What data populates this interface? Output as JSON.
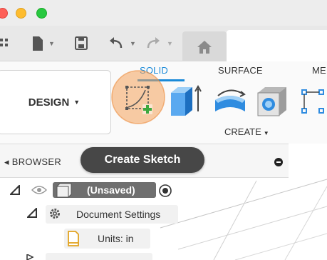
{
  "ribbon": {
    "workspace_label": "DESIGN",
    "tabs": [
      {
        "label": "SOLID",
        "active": true
      },
      {
        "label": "SURFACE",
        "active": false
      },
      {
        "label": "ME",
        "active": false
      }
    ],
    "group_label": "CREATE"
  },
  "tooltip": {
    "text": "Create Sketch"
  },
  "browser": {
    "title": "BROWSER",
    "root_label": "(Unsaved)",
    "settings_label": "Document Settings",
    "units_label": "Units: in"
  },
  "colors": {
    "accent": "#1a8ad8",
    "highlight": "#f4a25b",
    "tooltip_bg": "#474747"
  }
}
